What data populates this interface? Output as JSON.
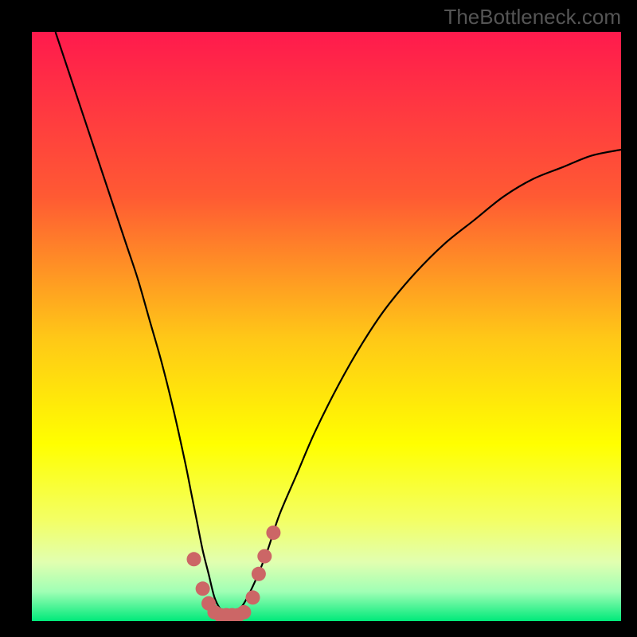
{
  "watermark": "TheBottleneck.com",
  "chart_data": {
    "type": "line",
    "title": "",
    "xlabel": "",
    "ylabel": "",
    "xlim": [
      0,
      100
    ],
    "ylim": [
      0,
      100
    ],
    "background_gradient": {
      "stops": [
        {
          "offset": 0.0,
          "color": "#ff1a4d"
        },
        {
          "offset": 0.28,
          "color": "#ff5a33"
        },
        {
          "offset": 0.52,
          "color": "#ffc817"
        },
        {
          "offset": 0.7,
          "color": "#ffff00"
        },
        {
          "offset": 0.83,
          "color": "#f3ff66"
        },
        {
          "offset": 0.9,
          "color": "#e1ffb0"
        },
        {
          "offset": 0.95,
          "color": "#a0ffb5"
        },
        {
          "offset": 1.0,
          "color": "#00e97a"
        }
      ]
    },
    "series": [
      {
        "name": "bottleneck-curve",
        "color": "#000000",
        "x": [
          4,
          6,
          8,
          10,
          12,
          14,
          16,
          18,
          20,
          22,
          24,
          26,
          27,
          28,
          29,
          30,
          31,
          32,
          33,
          34,
          35,
          36,
          38,
          40,
          42,
          45,
          48,
          52,
          56,
          60,
          65,
          70,
          75,
          80,
          85,
          90,
          95,
          100
        ],
        "y": [
          100,
          94,
          88,
          82,
          76,
          70,
          64,
          58,
          51,
          44,
          36,
          27,
          22,
          17,
          12,
          8,
          4,
          2,
          1,
          1,
          2,
          3,
          7,
          12,
          18,
          25,
          32,
          40,
          47,
          53,
          59,
          64,
          68,
          72,
          75,
          77,
          79,
          80
        ]
      }
    ],
    "markers": {
      "color": "#cc6666",
      "radius_px": 9,
      "points": [
        {
          "x": 27.5,
          "y": 10.5
        },
        {
          "x": 29.0,
          "y": 5.5
        },
        {
          "x": 30.0,
          "y": 3.0
        },
        {
          "x": 31.0,
          "y": 1.5
        },
        {
          "x": 32.0,
          "y": 1.0
        },
        {
          "x": 33.0,
          "y": 1.0
        },
        {
          "x": 34.0,
          "y": 1.0
        },
        {
          "x": 35.0,
          "y": 1.0
        },
        {
          "x": 36.0,
          "y": 1.5
        },
        {
          "x": 37.5,
          "y": 4.0
        },
        {
          "x": 38.5,
          "y": 8.0
        },
        {
          "x": 39.5,
          "y": 11.0
        },
        {
          "x": 41.0,
          "y": 15.0
        }
      ]
    }
  }
}
